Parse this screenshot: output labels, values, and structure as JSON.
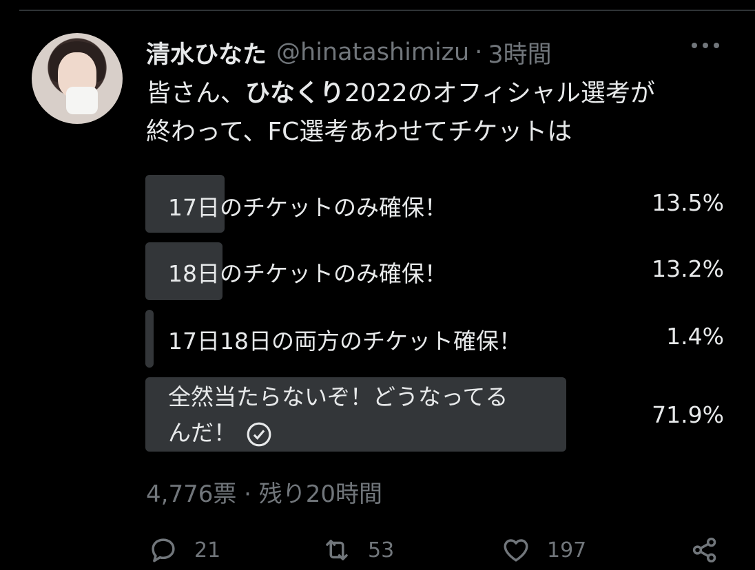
{
  "tweet": {
    "author_name": "清水ひなた",
    "handle": "@hinatashimizu",
    "separator": "·",
    "time": "3時間",
    "text_part1": "皆さん、",
    "text_bold": "ひなくり",
    "text_part2": "2022のオフィシャル選考が",
    "text_line2": "終わって、FC選考あわせてチケットは"
  },
  "poll": {
    "options": [
      {
        "label": "17日のチケットのみ確保！",
        "percent_text": "13.5%",
        "percent": 13.5
      },
      {
        "label": "18日のチケットのみ確保！",
        "percent_text": "13.2%",
        "percent": 13.2
      },
      {
        "label": "17日18日の両方のチケット確保！",
        "percent_text": "1.4%",
        "percent": 1.4
      },
      {
        "label_line1": "全然当たらないぞ！どうなってる",
        "label_line2": "んだ！",
        "percent_text": "71.9%",
        "percent": 71.9,
        "selected": true
      }
    ],
    "votes": "4,776票",
    "separator": "·",
    "remaining": "残り20時間"
  },
  "actions": {
    "reply_count": "21",
    "retweet_count": "53",
    "like_count": "197"
  },
  "icons": {
    "more": "more-horizontal-icon",
    "reply": "reply-icon",
    "retweet": "retweet-icon",
    "like": "heart-icon",
    "share": "share-icon",
    "check": "check-circle-icon"
  },
  "colors": {
    "background": "#000000",
    "text": "#e7e9ea",
    "muted": "#71767b",
    "poll_bar": "#333639"
  }
}
